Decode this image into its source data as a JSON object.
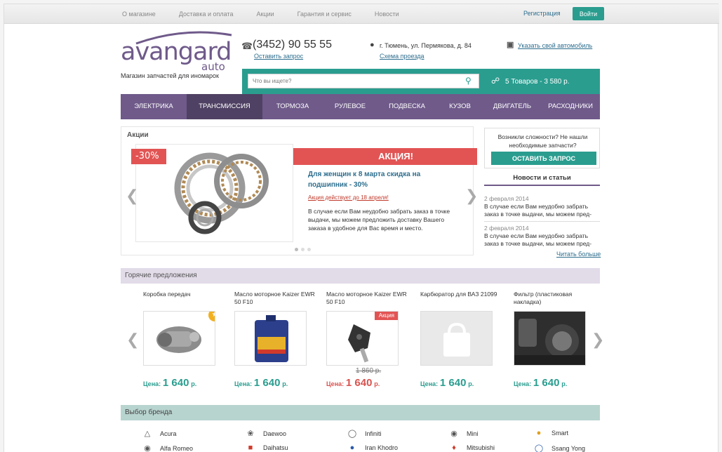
{
  "topbar": {
    "links": [
      "О магазине",
      "Доставка и оплата",
      "Акции",
      "Гарантия и сервис",
      "Новости"
    ],
    "register": "Регистрация",
    "login": "Войти"
  },
  "logo": {
    "word": "avangard",
    "sub": "auto",
    "tagline": "Магазин запчастей для иномарок"
  },
  "contacts": {
    "phone": "(3452) 90 55 55",
    "request_link": "Оставить запрос",
    "address": "г. Тюмень, ул. Пермякова, д. 84",
    "map_link": "Схема проезда",
    "car_link": "Указать свой автомобиль"
  },
  "search": {
    "placeholder": "Что вы ищете?",
    "cart": "5 Товаров - 3 580 р."
  },
  "categories": [
    "ЭЛЕКТРИКА",
    "ТРАНСМИССИЯ",
    "ТОРМОЗА",
    "РУЛЕВОЕ",
    "ПОДВЕСКА",
    "КУЗОВ",
    "ДВИГАТЕЛЬ",
    "РАСХОДНИКИ"
  ],
  "promo": {
    "heading": "Акции",
    "discount": "-30%",
    "banner": "АКЦИЯ!",
    "title": "Для женщин к 8 марта скидка на подшипник - 30%",
    "until": "Акция действует до 18 апреля!",
    "text": "В случае если Вам неудобно забрать заказ в точке выдачи, мы можем предложить доставку Вашего заказа в удобное для Вас время и место."
  },
  "help": {
    "question": "Возникли сложности? Не нашли необходимые запчасти?",
    "button": "ОСТАВИТЬ ЗАПРОС"
  },
  "news": {
    "heading": "Новости и статьи",
    "items": [
      {
        "date": "2 февраля 2014",
        "text": "В случае если Вам неудобно забрать заказ в точке выдачи, мы можем пред-"
      },
      {
        "date": "2 февраля 2014",
        "text": "В случае если Вам неудобно забрать заказ в точке выдачи, мы можем пред-"
      }
    ],
    "more": "Читать больше"
  },
  "hot": {
    "heading": "Горячие предложения",
    "price_label": "Цена:",
    "currency": "р.",
    "sale_tag": "Акция",
    "products": [
      {
        "name": "Коробка передач",
        "price": "1 640",
        "old": ""
      },
      {
        "name": "Масло моторное Kaizer EWR 50 F10",
        "price": "1 640",
        "old": ""
      },
      {
        "name": "Масло моторное Kaizer EWR 50 F10",
        "price": "1 640",
        "old": "1 860 р."
      },
      {
        "name": "Карбюратор для ВАЗ 21099",
        "price": "1 640",
        "old": ""
      },
      {
        "name": "Фильтр (пластиковая накладка)",
        "price": "1 640",
        "old": ""
      }
    ]
  },
  "brands": {
    "heading": "Выбор бренда",
    "list": [
      "Acura",
      "Daewoo",
      "Infiniti",
      "Mini",
      "Smart",
      "Alfa Romeo",
      "Daihatsu",
      "Iran Khodro",
      "Mitsubishi",
      "Ssang Yong"
    ]
  },
  "colors": {
    "accent": "#2a9d8f",
    "brand": "#6f5a8a",
    "sale": "#e25454"
  }
}
